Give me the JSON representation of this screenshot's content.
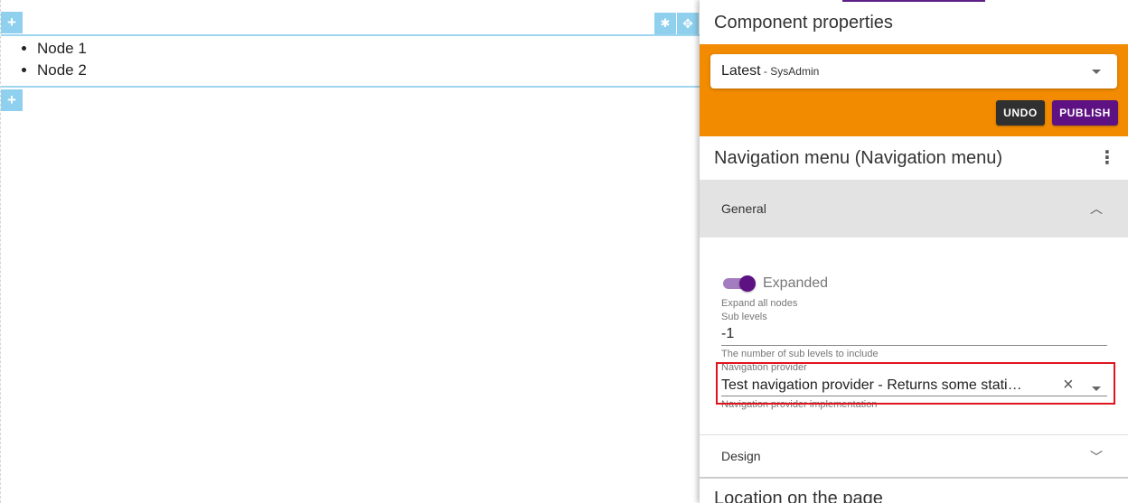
{
  "canvas": {
    "add_icon": "+",
    "settings_icon": "✱",
    "move_icon": "✥",
    "nodes": [
      "Node 1",
      "Node 2"
    ]
  },
  "panel": {
    "title": "Component properties",
    "version": {
      "label": "Latest",
      "separator": " - ",
      "user": "SysAdmin"
    },
    "undo_label": "UNDO",
    "publish_label": "PUBLISH",
    "component_title": "Navigation menu (Navigation menu)",
    "general": {
      "label": "General",
      "expanded": {
        "label": "Expanded",
        "value": true,
        "help": "Expand all nodes"
      },
      "sub_levels": {
        "label": "Sub levels",
        "value": "-1",
        "help": "The number of sub levels to include"
      },
      "navigation_provider": {
        "label": "Navigation provider",
        "value": "Test navigation provider - Returns some static navigation items",
        "help": "Navigation provider implementation"
      }
    },
    "design_label": "Design",
    "location_title": "Location on the page"
  },
  "colors": {
    "accent_purple": "#5d1183",
    "header_orange": "#f28b00",
    "drop_zone_blue": "#8fd0ee",
    "highlight_red": "#e0141e"
  }
}
